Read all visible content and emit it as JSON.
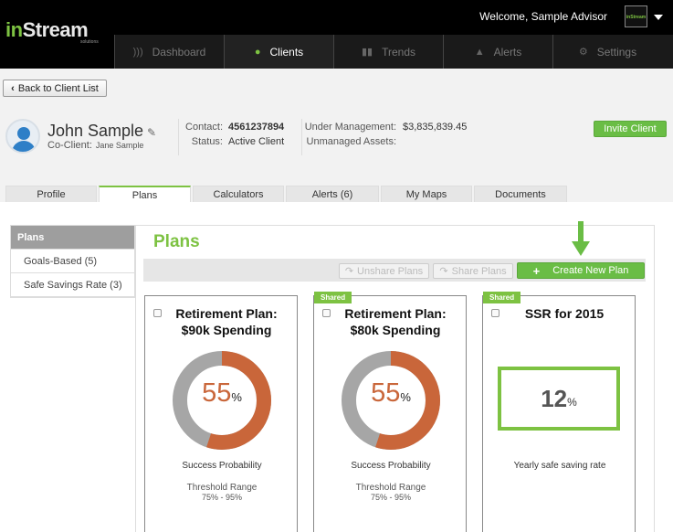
{
  "header": {
    "logo_primary": "in",
    "logo_secondary": "Stream",
    "logo_sub": "solutions",
    "welcome": "Welcome, Sample Advisor",
    "avatar_text": "inStream"
  },
  "nav": {
    "items": [
      {
        "label": "Dashboard",
        "icon": "rss-icon",
        "active": false
      },
      {
        "label": "Clients",
        "icon": "user-icon",
        "active": true
      },
      {
        "label": "Trends",
        "icon": "bar-chart-icon",
        "active": false
      },
      {
        "label": "Alerts",
        "icon": "bell-icon",
        "active": false
      },
      {
        "label": "Settings",
        "icon": "gear-icon",
        "active": false
      }
    ]
  },
  "back_button": "Back to Client List",
  "client": {
    "name": "John Sample",
    "coclient_label": "Co-Client:",
    "coclient_value": "Jane Sample",
    "contact_label": "Contact:",
    "contact_value": "4561237894",
    "status_label": "Status:",
    "status_value": "Active Client",
    "aum_label": "Under Management:",
    "aum_value": "$3,835,839.45",
    "unmanaged_label": "Unmanaged Assets:",
    "unmanaged_value": "",
    "invite_label": "Invite Client"
  },
  "subtabs": [
    {
      "label": "Profile",
      "active": false
    },
    {
      "label": "Plans",
      "active": true
    },
    {
      "label": "Calculators",
      "active": false
    },
    {
      "label": "Alerts (6)",
      "active": false
    },
    {
      "label": "My Maps",
      "active": false
    },
    {
      "label": "Documents",
      "active": false
    }
  ],
  "sidebar": {
    "header": "Plans",
    "items": [
      "Goals-Based (5)",
      "Safe Savings Rate (3)"
    ]
  },
  "plans": {
    "title": "Plans",
    "unshare_label": "Unshare Plans",
    "share_label": "Share Plans",
    "create_label": "Create New Plan",
    "cards": [
      {
        "shared": false,
        "title": "Retirement Plan: $90k Spending",
        "value": "55",
        "unit": "%",
        "success_fraction": 0.55,
        "caption": "Success Probability",
        "threshold_label": "Threshold Range",
        "threshold_value": "75% - 95%"
      },
      {
        "shared": true,
        "shared_label": "Shared",
        "title": "Retirement Plan: $80k Spending",
        "value": "55",
        "unit": "%",
        "success_fraction": 0.55,
        "caption": "Success Probability",
        "threshold_label": "Threshold Range",
        "threshold_value": "75% - 95%"
      },
      {
        "shared": true,
        "shared_label": "Shared",
        "title": "SSR for 2015",
        "value": "12",
        "unit": "%",
        "caption": "Yearly safe saving rate"
      }
    ]
  },
  "colors": {
    "brand_green": "#7dc242",
    "donut_fill": "#c9663a",
    "donut_track": "#a6a6a6"
  }
}
